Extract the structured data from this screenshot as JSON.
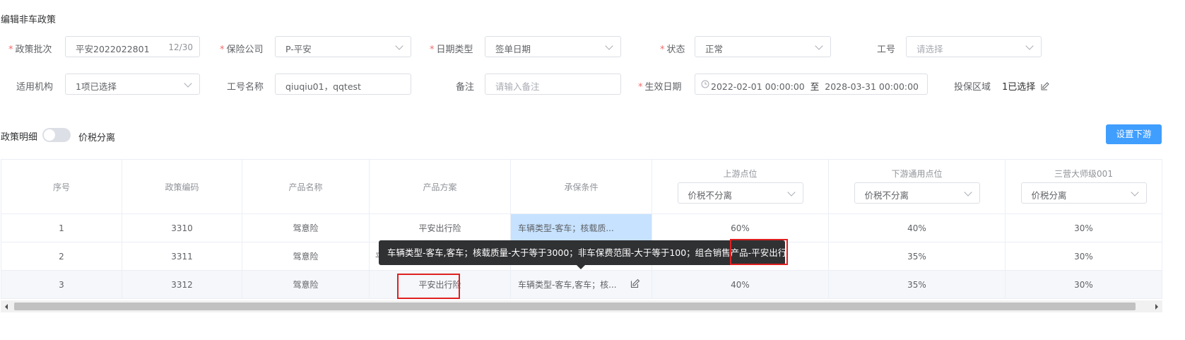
{
  "title": "编辑非车政策",
  "form": {
    "batch_label": "政策批次",
    "batch_value": "平安2022022801",
    "batch_count": "12/30",
    "insurer_label": "保险公司",
    "insurer_value": "P-平安",
    "date_type_label": "日期类型",
    "date_type_value": "签单日期",
    "status_label": "状态",
    "status_value": "正常",
    "job_no_label": "工号",
    "job_no_placeholder": "请选择",
    "org_label": "适用机构",
    "org_value": "1项已选择",
    "job_name_label": "工号名称",
    "job_name_value": "qiuqiu01，qqtest",
    "remark_label": "备注",
    "remark_placeholder": "请输入备注",
    "effective_label": "生效日期",
    "effective_start": "2022-02-01 00:00:00",
    "effective_sep": "至",
    "effective_end": "2028-03-31 00:00:00",
    "region_label": "投保区域",
    "region_value": "1已选择"
  },
  "detail": {
    "label": "政策明细",
    "toggle_label": "价税分离",
    "set_downstream_button": "设置下游"
  },
  "table": {
    "headers": {
      "seq": "序号",
      "code": "政策编码",
      "product": "产品名称",
      "plan": "产品方案",
      "condition": "承保条件",
      "upstream": "上游点位",
      "upstream_select": "价税不分离",
      "downstream": "下游通用点位",
      "downstream_select": "价税不分离",
      "master": "三营大师级001",
      "master_select": "价税分离"
    },
    "rows": [
      {
        "seq": "1",
        "code": "3310",
        "product": "驾意险",
        "plan": "平安出行险",
        "condition": "车辆类型-客车；核载质...",
        "upstream": "60%",
        "downstream": "40%",
        "master": "30%"
      },
      {
        "seq": "2",
        "code": "3311",
        "product": "驾意险",
        "plan": "平",
        "condition": "",
        "upstream": "",
        "downstream": "35%",
        "master": "30%"
      },
      {
        "seq": "3",
        "code": "3312",
        "product": "驾意险",
        "plan": "平安出行险",
        "condition": "车辆类型-客车,客车；核...",
        "upstream": "40%",
        "downstream": "35%",
        "master": "30%"
      }
    ]
  },
  "tooltip": {
    "text_before": "车辆类型-客车,客车；核载质量-大于等于3000；非车保费范围-大于等于100；组合销售产品-",
    "text_highlight": "平安出行险"
  },
  "colors": {
    "primary": "#409eff",
    "required": "#f56c6c",
    "highlight_cell": "#c6e2ff",
    "annotation": "#e02020"
  }
}
